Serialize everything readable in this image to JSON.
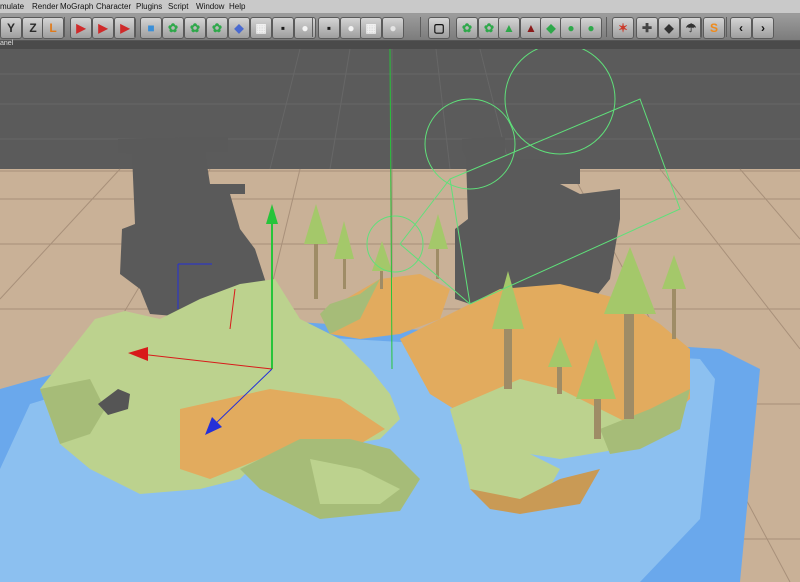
{
  "menu": {
    "items": [
      "mulate",
      "Render",
      "MoGraph",
      "Character",
      "Plugins",
      "Script",
      "Window",
      "Help"
    ]
  },
  "toolbar": {
    "buttons": [
      {
        "name": "axis-y-button",
        "glyph": "Y",
        "color": "#2a2a2a"
      },
      {
        "name": "axis-z-button",
        "glyph": "Z",
        "color": "#2a2a2a"
      },
      {
        "name": "object-coordinates-button",
        "glyph": "L",
        "color": "#e07a1a"
      },
      {
        "name": "render-view-button",
        "glyph": "▶",
        "color": "#cf2a2a"
      },
      {
        "name": "render-picture-viewer-button",
        "glyph": "▶",
        "color": "#cf2a2a"
      },
      {
        "name": "render-settings-button",
        "glyph": "▶",
        "color": "#cf2a2a"
      },
      {
        "name": "cube-primitive-button",
        "glyph": "■",
        "color": "#3a8fd8"
      },
      {
        "name": "subdivision-button",
        "glyph": "✿",
        "color": "#2ea84a"
      },
      {
        "name": "array-button",
        "glyph": "✿",
        "color": "#2ea84a"
      },
      {
        "name": "cloner-button",
        "glyph": "✿",
        "color": "#2ea84a"
      },
      {
        "name": "deformer-button",
        "glyph": "◆",
        "color": "#4a6ad0"
      },
      {
        "name": "floor-button",
        "glyph": "▦",
        "color": "#f0f0f0"
      },
      {
        "name": "camera-button",
        "glyph": "▪",
        "color": "#1a1a1a"
      },
      {
        "name": "light-button",
        "glyph": "●",
        "color": "#f4f4f4"
      },
      {
        "name": "sky-camera-button",
        "glyph": "▪",
        "color": "#1a1a1a"
      },
      {
        "name": "light-bulb-button",
        "glyph": "●",
        "color": "#f4f4f4"
      },
      {
        "name": "environment-button",
        "glyph": "▦",
        "color": "#f0f0f0"
      },
      {
        "name": "sphere-button",
        "glyph": "●",
        "color": "#e4e4e4"
      },
      {
        "name": "display-mode-button",
        "glyph": "▢",
        "color": "#111111"
      },
      {
        "name": "xpresso-button",
        "glyph": "✿",
        "color": "#2ea84a"
      },
      {
        "name": "mograph-effector-button",
        "glyph": "✿",
        "color": "#2ea84a"
      },
      {
        "name": "fracture-button",
        "glyph": "▲",
        "color": "#2ea84a"
      },
      {
        "name": "pyramid-button",
        "glyph": "▲",
        "color": "#8a1a1a"
      },
      {
        "name": "mograph-tools-button",
        "glyph": "◆",
        "color": "#2ea84a"
      },
      {
        "name": "hair-button",
        "glyph": "●",
        "color": "#2ea84a"
      },
      {
        "name": "cluster-button",
        "glyph": "●",
        "color": "#2ea84a"
      },
      {
        "name": "snap-button",
        "glyph": "✶",
        "color": "#cc3a2a"
      },
      {
        "name": "workplane-button",
        "glyph": "✚",
        "color": "#444444"
      },
      {
        "name": "quantize-button",
        "glyph": "◆",
        "color": "#333333"
      },
      {
        "name": "sketch-toon-button",
        "glyph": "☂",
        "color": "#333333"
      },
      {
        "name": "plugin-s-button",
        "glyph": "S",
        "color": "#f08a1a"
      },
      {
        "name": "back-arrow-button",
        "glyph": "‹",
        "color": "#111111"
      },
      {
        "name": "forward-arrow-button",
        "glyph": "›",
        "color": "#111111"
      }
    ]
  },
  "panel": {
    "label": "anel"
  },
  "viewport": {
    "colors": {
      "sky": "#5b5b5b",
      "ground": "#c9b197",
      "water": "#8cc0f0",
      "water_deep": "#6aa8ec",
      "grass": "#bcd28e",
      "grass_shade": "#a6bc78",
      "sand": "#e2ab5e",
      "sand_shade": "#c99a55",
      "tree_trunk": "#9f8c66",
      "tree_leaf": "#a4c86a",
      "tower": "#5a5a5a",
      "camera_wire": "#5fe07a"
    }
  }
}
